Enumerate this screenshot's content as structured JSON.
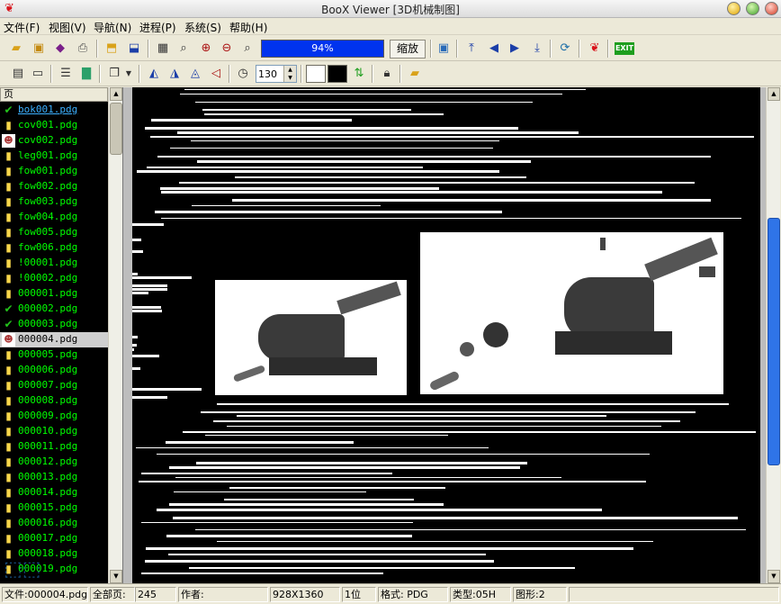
{
  "window": {
    "title": "BooX Viewer [3D机械制图]"
  },
  "menu": [
    "文件(F)",
    "视图(V)",
    "导航(N)",
    "进程(P)",
    "系统(S)",
    "帮助(H)"
  ],
  "toolbar": {
    "progress": "94%",
    "zoom_label": "缩放",
    "exit_label": "EXIT",
    "rotation_value": "130"
  },
  "colors": {
    "progress": "#0033ee",
    "file_text": "#00ff00",
    "scroll_thumb": "#2f74e8"
  },
  "panel": {
    "header": "页"
  },
  "files": [
    {
      "name": "bok001.pdg",
      "icon": "check-icon"
    },
    {
      "name": "cov001.pdg",
      "icon": "page-icon"
    },
    {
      "name": "cov002.pdg",
      "icon": "picture-icon"
    },
    {
      "name": "leg001.pdg",
      "icon": "page-icon"
    },
    {
      "name": "fow001.pdg",
      "icon": "page-icon"
    },
    {
      "name": "fow002.pdg",
      "icon": "page-icon"
    },
    {
      "name": "fow003.pdg",
      "icon": "page-icon"
    },
    {
      "name": "fow004.pdg",
      "icon": "page-icon"
    },
    {
      "name": "fow005.pdg",
      "icon": "page-icon"
    },
    {
      "name": "fow006.pdg",
      "icon": "page-icon"
    },
    {
      "name": "!00001.pdg",
      "icon": "page-icon"
    },
    {
      "name": "!00002.pdg",
      "icon": "page-icon"
    },
    {
      "name": "000001.pdg",
      "icon": "page-icon"
    },
    {
      "name": "000002.pdg",
      "icon": "check-icon"
    },
    {
      "name": "000003.pdg",
      "icon": "check-icon"
    },
    {
      "name": "000004.pdg",
      "icon": "picture-icon"
    },
    {
      "name": "000005.pdg",
      "icon": "page-icon"
    },
    {
      "name": "000006.pdg",
      "icon": "page-icon"
    },
    {
      "name": "000007.pdg",
      "icon": "page-icon"
    },
    {
      "name": "000008.pdg",
      "icon": "page-icon"
    },
    {
      "name": "000009.pdg",
      "icon": "page-icon"
    },
    {
      "name": "000010.pdg",
      "icon": "page-icon"
    },
    {
      "name": "000011.pdg",
      "icon": "page-icon"
    },
    {
      "name": "000012.pdg",
      "icon": "page-icon"
    },
    {
      "name": "000013.pdg",
      "icon": "page-icon"
    },
    {
      "name": "000014.pdg",
      "icon": "page-icon"
    },
    {
      "name": "000015.pdg",
      "icon": "page-icon"
    },
    {
      "name": "000016.pdg",
      "icon": "page-icon"
    },
    {
      "name": "000017.pdg",
      "icon": "page-icon"
    },
    {
      "name": "000018.pdg",
      "icon": "page-icon"
    },
    {
      "name": "000019.pdg",
      "icon": "page-icon"
    }
  ],
  "selected_file": "000004.pdg",
  "status": {
    "file": "文件:000004.pdg",
    "total_pages": "全部页:",
    "total_count": "245",
    "author": "作者:",
    "resolution": "928X1360",
    "bits": "1位",
    "format": "格式: PDG",
    "type": "类型:05H",
    "graphics": "图形:2"
  }
}
